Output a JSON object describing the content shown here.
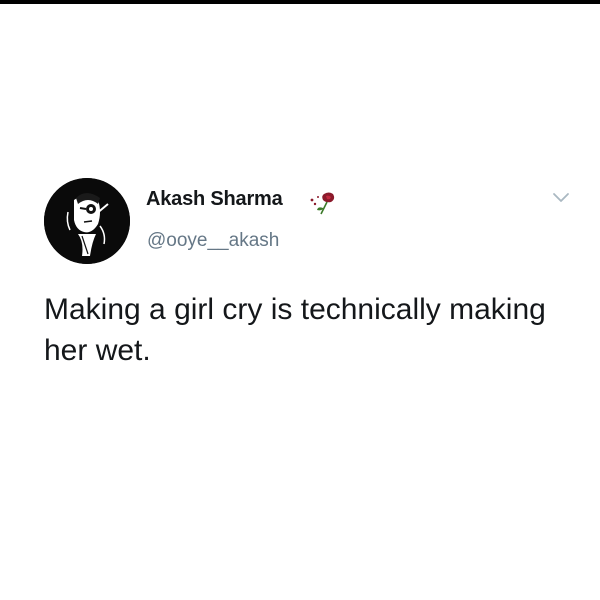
{
  "tweet": {
    "display_name": "Akash Sharma",
    "handle": "@ooye__akash",
    "text": "Making a girl cry is technically making her wet.",
    "avatar_icon": "profile-picture-icon",
    "name_badge_icon": "rose-emoji-icon",
    "menu_icon": "chevron-down-icon"
  },
  "colors": {
    "text_primary": "#14171a",
    "text_secondary": "#657786",
    "background": "#ffffff",
    "chevron": "#aab8c2"
  }
}
